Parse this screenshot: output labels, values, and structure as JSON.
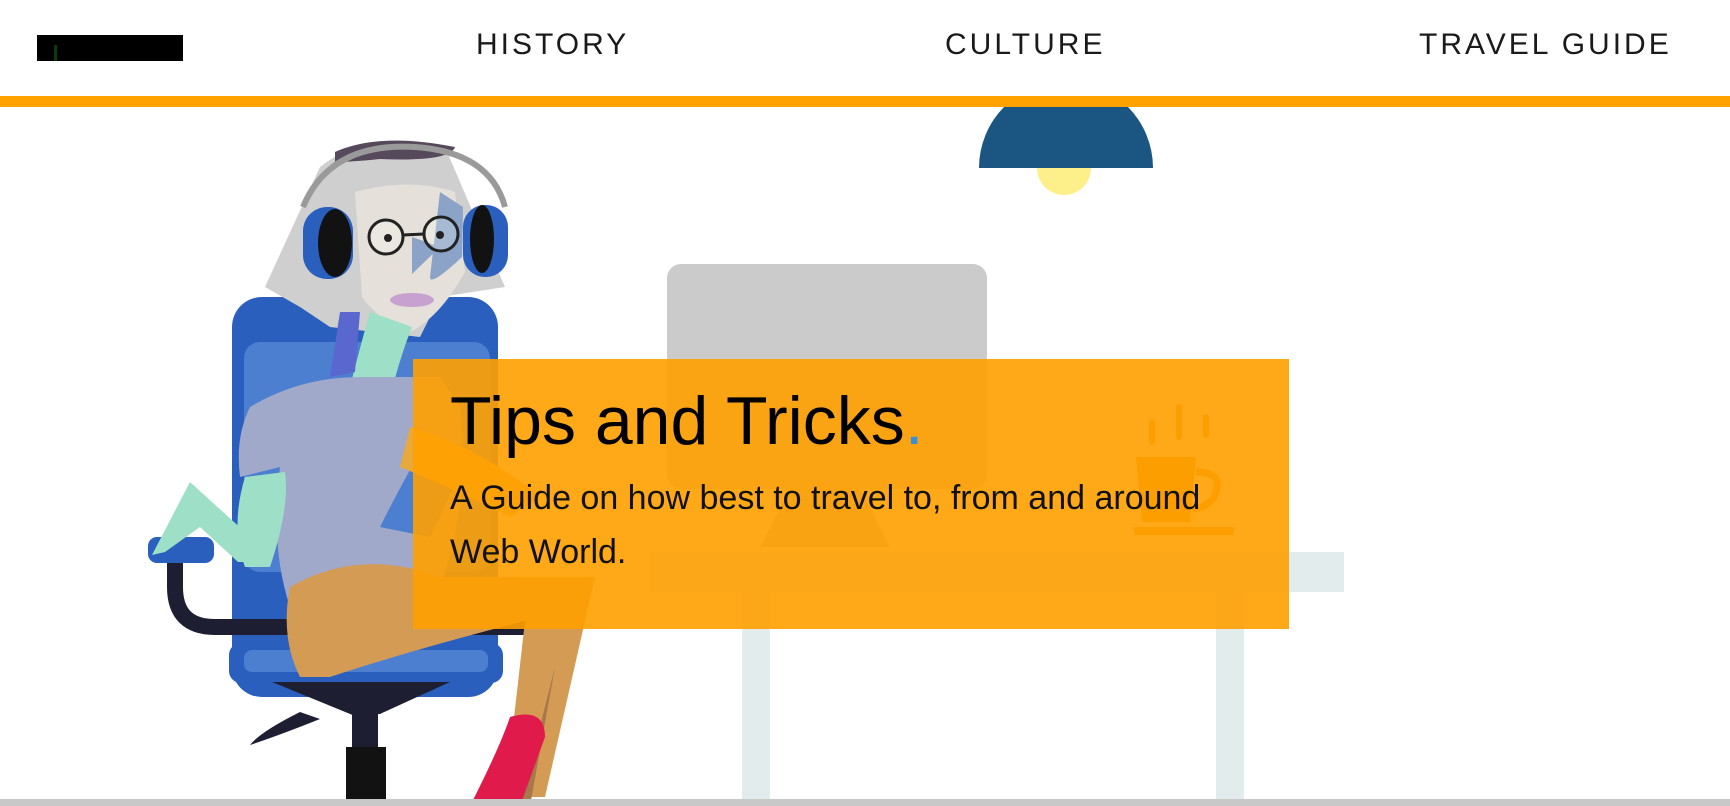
{
  "nav": {
    "items": [
      {
        "label": "HISTORY"
      },
      {
        "label": "CULTURE"
      },
      {
        "label": "TRAVEL GUIDE"
      }
    ]
  },
  "hero": {
    "title": "Tips and Tricks",
    "title_dot": ".",
    "subtitle": "A Guide on how best to travel to, from and around Web World."
  },
  "colors": {
    "accent": "#ffa200",
    "dot": "#3a8fd6"
  }
}
